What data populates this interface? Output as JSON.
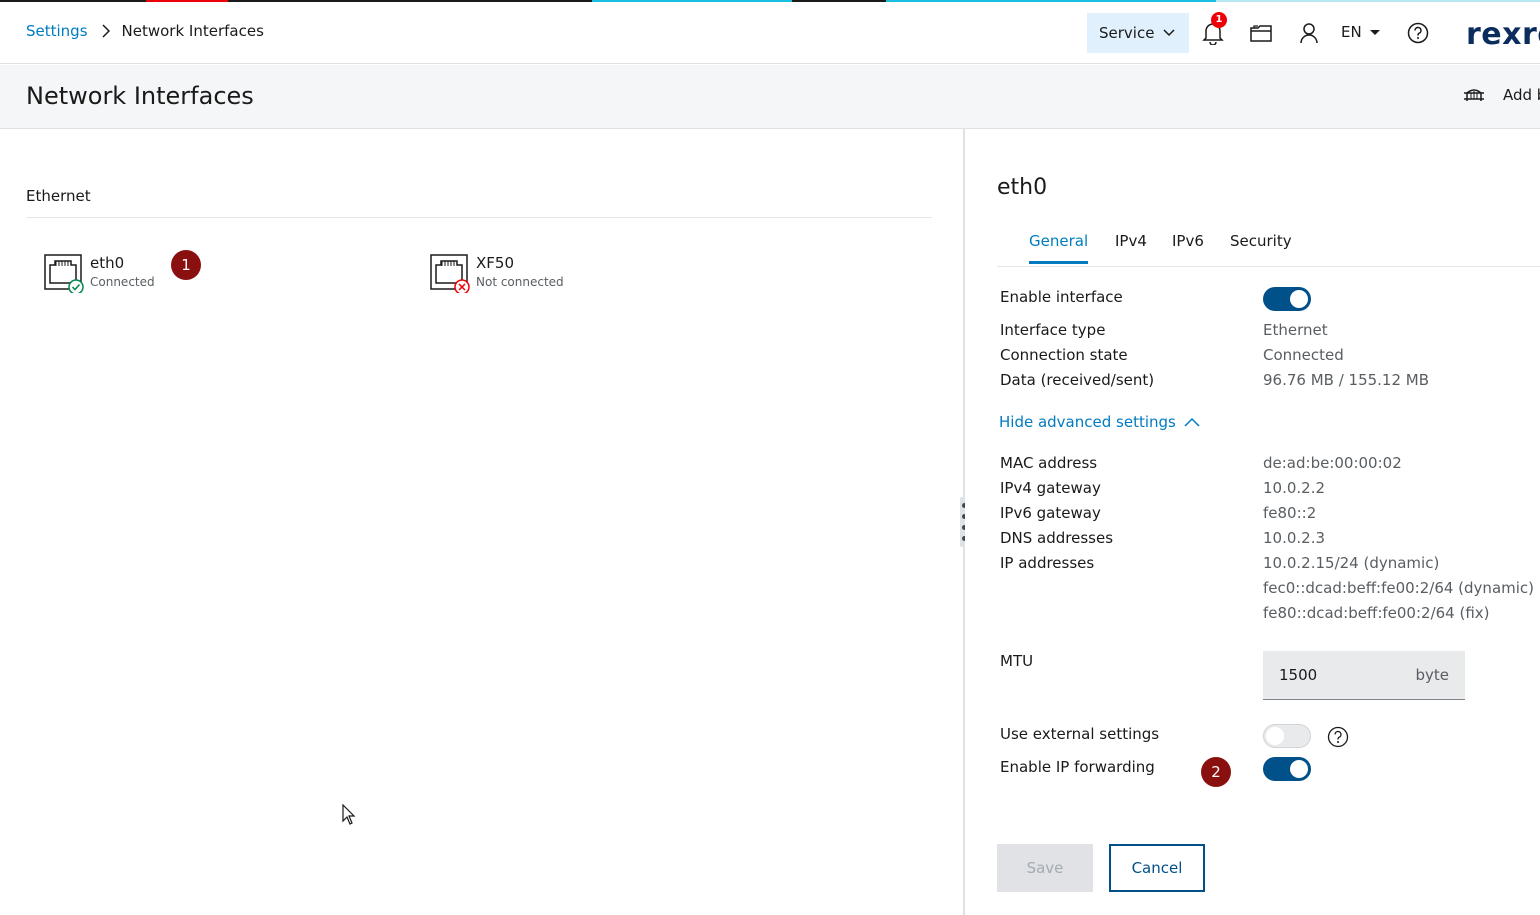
{
  "colors": {
    "accent": "#007bc0",
    "toggle_on": "#00508a",
    "marker": "#8a0f0f",
    "notification_badge": "#ed0007",
    "success": "#00884a",
    "error": "#ed0007",
    "strip": [
      "#1a1a1a",
      "#ed0007",
      "#1a1a1a",
      "#18c0e0",
      "#1a1a1a",
      "#18c0e0",
      "#b8e8f2"
    ]
  },
  "header": {
    "breadcrumb": {
      "root": "Settings",
      "current": "Network Interfaces"
    },
    "service_label": "Service",
    "notification_count": "1",
    "language": "EN",
    "logo_text": "rexroth",
    "icons": [
      "bell-icon",
      "folder-icon",
      "user-icon",
      "help-icon"
    ]
  },
  "titlebar": {
    "title": "Network Interfaces",
    "add_label": "Add bridge"
  },
  "left": {
    "section_title": "Ethernet",
    "interfaces": [
      {
        "name": "eth0",
        "state": "Connected",
        "status": "ok",
        "marker": "1"
      },
      {
        "name": "XF50",
        "state": "Not connected",
        "status": "error"
      }
    ]
  },
  "detail": {
    "title": "eth0",
    "tabs": [
      {
        "label": "General",
        "active": true
      },
      {
        "label": "IPv4",
        "active": false
      },
      {
        "label": "IPv6",
        "active": false
      },
      {
        "label": "Security",
        "active": false
      }
    ],
    "enable_interface": {
      "label": "Enable interface",
      "on": true
    },
    "info": [
      {
        "label": "Interface type",
        "value": "Ethernet"
      },
      {
        "label": "Connection state",
        "value": "Connected"
      },
      {
        "label": "Data (received/sent)",
        "value": "96.76 MB / 155.12 MB"
      }
    ],
    "advanced_link": "Hide advanced settings",
    "advanced": [
      {
        "label": "MAC address",
        "value": "de:ad:be:00:00:02"
      },
      {
        "label": "IPv4 gateway",
        "value": "10.0.2.2"
      },
      {
        "label": "IPv6 gateway",
        "value": "fe80::2"
      },
      {
        "label": "DNS addresses",
        "value": "10.0.2.3"
      },
      {
        "label": "IP addresses",
        "values": [
          "10.0.2.15/24 (dynamic)",
          "fec0::dcad:beff:fe00:2/64 (dynamic)",
          "fe80::dcad:beff:fe00:2/64 (fix)"
        ]
      }
    ],
    "mtu": {
      "label": "MTU",
      "value": "1500",
      "unit": "byte"
    },
    "use_external": {
      "label": "Use external settings",
      "on": false
    },
    "ip_forwarding": {
      "label": "Enable IP forwarding",
      "on": true,
      "marker": "2"
    },
    "save_label": "Save",
    "cancel_label": "Cancel"
  }
}
